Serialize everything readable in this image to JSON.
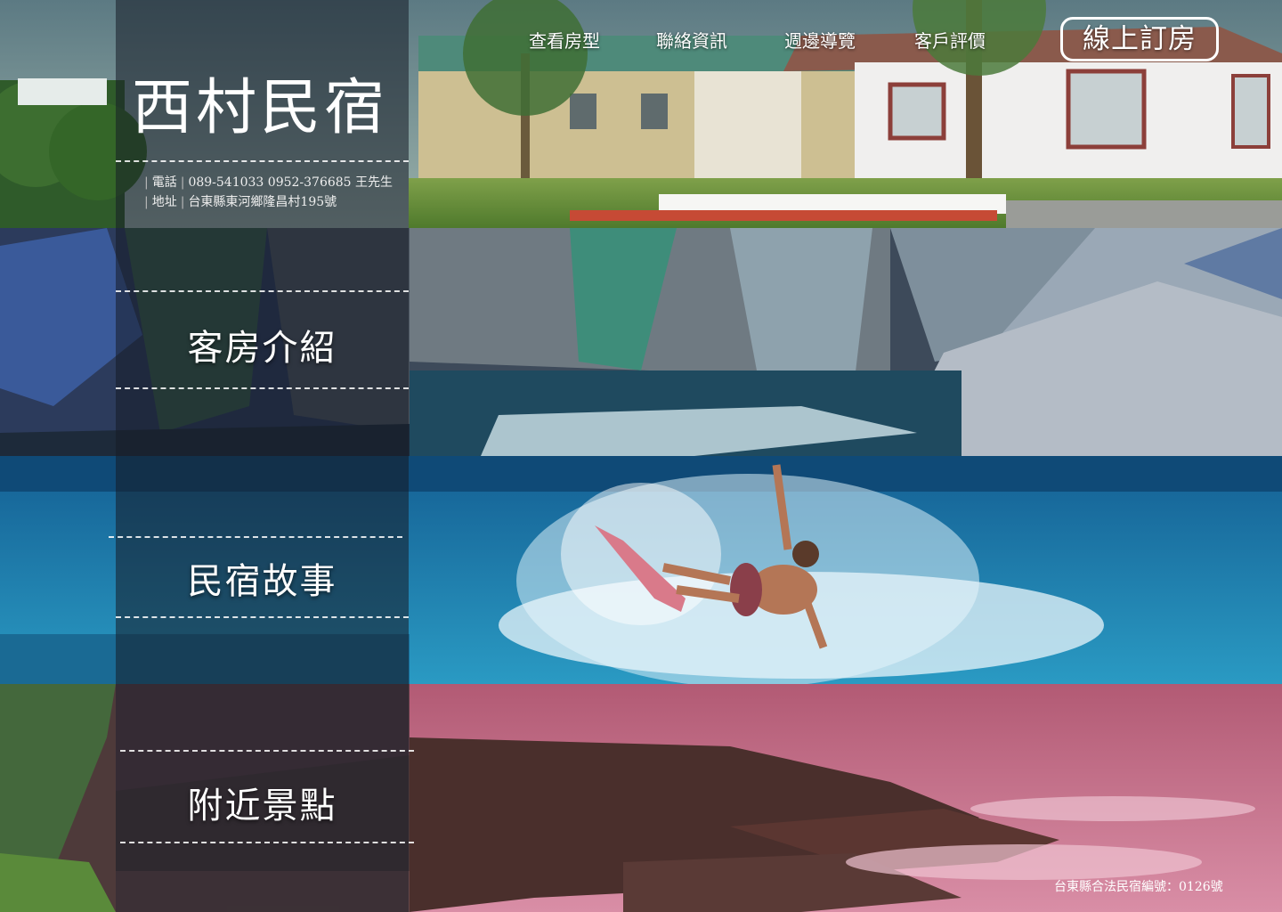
{
  "brand": {
    "title": "西村民宿",
    "phone_label": "電話",
    "phone_value": "089-541033 0952-376685 王先生",
    "address_label": "地址",
    "address_value": "台東縣東河鄉隆昌村195號"
  },
  "nav": {
    "items": [
      {
        "label": "查看房型"
      },
      {
        "label": "聯絡資訊"
      },
      {
        "label": "週邊導覽"
      },
      {
        "label": "客戶評價"
      }
    ],
    "book_label": "線上訂房"
  },
  "sections": [
    {
      "label": "客房介紹"
    },
    {
      "label": "民宿故事"
    },
    {
      "label": "附近景點"
    }
  ],
  "footer": {
    "license": "台東縣合法民宿編號：0126號"
  },
  "colors": {
    "panel": "#161c26",
    "surf_sea": "#1e7fb0",
    "coast_tint": "#c46a82"
  }
}
